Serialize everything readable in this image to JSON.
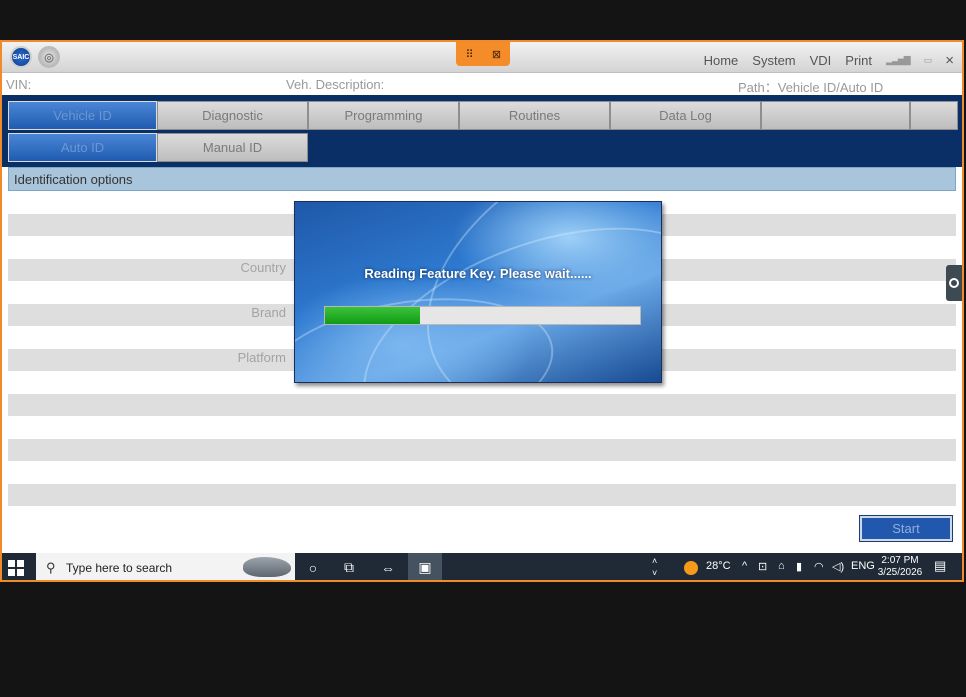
{
  "app": {
    "remote_controls": {
      "drag_icon": "grip-icon",
      "close_icon": "close-icon"
    },
    "menu": [
      "Home",
      "System",
      "VDI",
      "Print"
    ],
    "window_close": "×"
  },
  "info": {
    "vin_label": "VIN:",
    "veh_desc_label": "Veh. Description:",
    "path": "Path：Vehicle ID/Auto ID"
  },
  "tabs": {
    "primary": [
      "Vehicle ID",
      "Diagnostic",
      "Programming",
      "Routines",
      "Data Log",
      ""
    ],
    "secondary": [
      "Auto ID",
      "Manual ID"
    ],
    "active_primary": "Vehicle ID",
    "active_secondary": "Auto ID"
  },
  "section": {
    "title": "Identification options",
    "fields": [
      "Country",
      "Brand",
      "Platform"
    ]
  },
  "dialog": {
    "message": "Reading Feature Key. Please wait......",
    "progress_fraction": 0.3
  },
  "actions": {
    "start_label": "Start"
  },
  "taskbar": {
    "search_placeholder": "Type here to search",
    "weather_temp": "28°C",
    "language": "ENG",
    "time": "2:07 PM",
    "date": "3/25/2026"
  },
  "colors": {
    "accent_orange": "#f08a2a",
    "nav_blue": "#0a2e66",
    "section_header": "#a8c5db",
    "progress_green": "#119b15"
  }
}
